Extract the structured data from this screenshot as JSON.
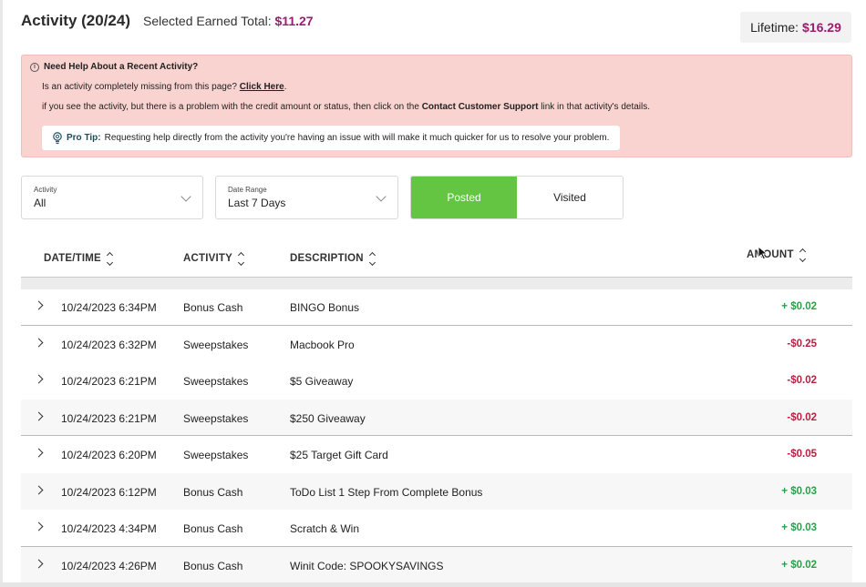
{
  "header": {
    "title": "Activity (20/24)",
    "selected_label": "Selected Earned Total:",
    "selected_amount": "$11.27",
    "lifetime_label": "Lifetime:",
    "lifetime_amount": "$16.29"
  },
  "help": {
    "title": "Need Help About a Recent Activity?",
    "line1_text": "Is an activity completely missing from this page?",
    "line1_link": "Click Here",
    "line2_pre": "if you see the activity, but there is a problem with the credit amount or status, then click on the",
    "line2_bold": "Contact Customer Support",
    "line2_post": "link in that activity's details.",
    "pro_tip_label": "Pro Tip:",
    "pro_tip_text": "Requesting help directly from the activity you're having an issue with will make it much quicker for us to resolve your problem."
  },
  "filters": {
    "activity_label": "Activity",
    "activity_value": "All",
    "date_label": "Date Range",
    "date_value": "Last 7 Days"
  },
  "toggle": {
    "posted": "Posted",
    "visited": "Visited",
    "active": "posted",
    "active_color": "#63c542"
  },
  "table": {
    "headers": {
      "date": "DATE/TIME",
      "activity": "ACTIVITY",
      "description": "DESCRIPTION",
      "amount": "AMOUNT"
    },
    "rows": [
      {
        "date": "10/24/2023 6:34PM",
        "activity": "Bonus Cash",
        "description": "BINGO Bonus",
        "amount": "+ $0.02",
        "type": "pos"
      },
      {
        "date": "10/24/2023 6:32PM",
        "activity": "Sweepstakes",
        "description": "Macbook Pro",
        "amount": "-$0.25",
        "type": "neg"
      },
      {
        "date": "10/24/2023 6:21PM",
        "activity": "Sweepstakes",
        "description": "$5 Giveaway",
        "amount": "-$0.02",
        "type": "neg"
      },
      {
        "date": "10/24/2023 6:21PM",
        "activity": "Sweepstakes",
        "description": "$250 Giveaway",
        "amount": "-$0.02",
        "type": "neg"
      },
      {
        "date": "10/24/2023 6:20PM",
        "activity": "Sweepstakes",
        "description": "$25 Target Gift Card",
        "amount": "-$0.05",
        "type": "neg"
      },
      {
        "date": "10/24/2023 6:12PM",
        "activity": "Bonus Cash",
        "description": "ToDo List 1 Step From Complete Bonus",
        "amount": "+ $0.03",
        "type": "pos"
      },
      {
        "date": "10/24/2023 4:34PM",
        "activity": "Bonus Cash",
        "description": "Scratch & Win",
        "amount": "+ $0.03",
        "type": "pos"
      },
      {
        "date": "10/24/2023 4:26PM",
        "activity": "Bonus Cash",
        "description": "Winit Code: SPOOKYSAVINGS",
        "amount": "+ $0.02",
        "type": "pos"
      }
    ]
  },
  "colors": {
    "brand_amount": "#9b1c6e",
    "positive": "#2e9e4a",
    "negative": "#b32240",
    "help_background": "#f8d3cf"
  },
  "icons": [
    "info-icon",
    "lightbulb-icon",
    "chevron-down-icon",
    "sort-icon",
    "chevron-right-icon",
    "mouse-cursor-icon"
  ]
}
